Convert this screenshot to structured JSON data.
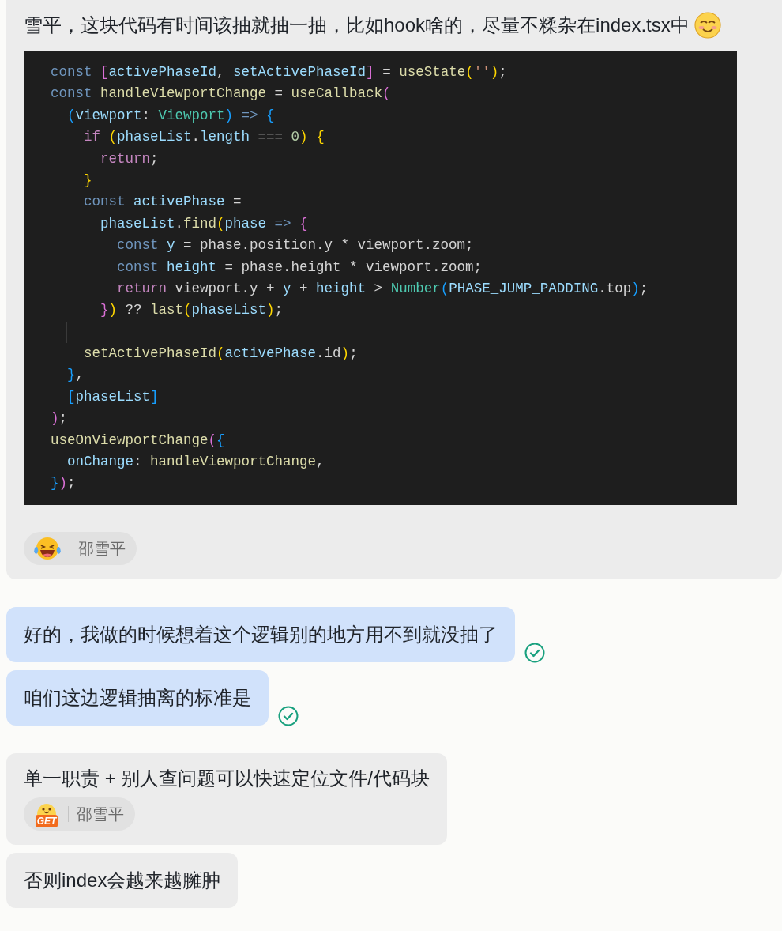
{
  "messages": [
    {
      "kind": "incoming",
      "text": "雪平，这块代码有时间该抽就抽一抽，比如hook啥的，尽量不糅杂在index.tsx中",
      "inline_emoji": {
        "kind": "smiling"
      },
      "code": [
        {
          "tokens": [
            {
              "kind": "keyword",
              "text": "const"
            },
            {
              "kind": "pink",
              "text": " ["
            },
            {
              "kind": "variable",
              "text": "activePhaseId"
            },
            {
              "kind": "plain",
              "text": ", "
            },
            {
              "kind": "variable",
              "text": "setActivePhaseId"
            },
            {
              "kind": "pink",
              "text": "]"
            },
            {
              "kind": "plain",
              "text": " = "
            },
            {
              "kind": "function",
              "text": "useState"
            },
            {
              "kind": "gold",
              "text": "("
            },
            {
              "kind": "string",
              "text": "''"
            },
            {
              "kind": "gold",
              "text": ")"
            },
            {
              "kind": "plain",
              "text": ";"
            }
          ]
        },
        {
          "tokens": [
            {
              "kind": "keyword",
              "text": "const"
            },
            {
              "kind": "function",
              "text": " handleViewportChange"
            },
            {
              "kind": "plain",
              "text": " = "
            },
            {
              "kind": "function",
              "text": "useCallback"
            },
            {
              "kind": "pink",
              "text": "("
            }
          ]
        },
        {
          "tokens": [
            {
              "kind": "blue",
              "text": "  ("
            },
            {
              "kind": "variable",
              "text": "viewport"
            },
            {
              "kind": "plain",
              "text": ": "
            },
            {
              "kind": "type",
              "text": "Viewport"
            },
            {
              "kind": "blue",
              "text": ")"
            },
            {
              "kind": "keyword",
              "text": " =>"
            },
            {
              "kind": "blue",
              "text": " {"
            }
          ]
        },
        {
          "tokens": [
            {
              "kind": "control",
              "text": "    if"
            },
            {
              "kind": "gold",
              "text": " ("
            },
            {
              "kind": "variable",
              "text": "phaseList"
            },
            {
              "kind": "plain",
              "text": "."
            },
            {
              "kind": "variable",
              "text": "length"
            },
            {
              "kind": "plain",
              "text": " === "
            },
            {
              "kind": "number",
              "text": "0"
            },
            {
              "kind": "gold",
              "text": ")"
            },
            {
              "kind": "gold",
              "text": " {"
            }
          ]
        },
        {
          "tokens": [
            {
              "kind": "control",
              "text": "      return"
            },
            {
              "kind": "plain",
              "text": ";"
            }
          ]
        },
        {
          "tokens": [
            {
              "kind": "gold",
              "text": "    }"
            }
          ]
        },
        {
          "tokens": [
            {
              "kind": "keyword",
              "text": "    const"
            },
            {
              "kind": "variable",
              "text": " activePhase"
            },
            {
              "kind": "plain",
              "text": " ="
            }
          ]
        },
        {
          "tokens": [
            {
              "kind": "variable",
              "text": "      phaseList"
            },
            {
              "kind": "plain",
              "text": "."
            },
            {
              "kind": "function",
              "text": "find"
            },
            {
              "kind": "gold",
              "text": "("
            },
            {
              "kind": "variable",
              "text": "phase"
            },
            {
              "kind": "keyword",
              "text": " =>"
            },
            {
              "kind": "pink",
              "text": " {"
            }
          ]
        },
        {
          "tokens": [
            {
              "kind": "keyword",
              "text": "        const"
            },
            {
              "kind": "variable",
              "text": " y"
            },
            {
              "kind": "plain",
              "text": " = phase.position.y * viewport.zoom;"
            }
          ]
        },
        {
          "tokens": [
            {
              "kind": "keyword",
              "text": "        const"
            },
            {
              "kind": "variable",
              "text": " height"
            },
            {
              "kind": "plain",
              "text": " = phase.height * viewport.zoom;"
            }
          ]
        },
        {
          "tokens": [
            {
              "kind": "control",
              "text": "        return"
            },
            {
              "kind": "plain",
              "text": " viewport.y + "
            },
            {
              "kind": "variable",
              "text": "y"
            },
            {
              "kind": "plain",
              "text": " + "
            },
            {
              "kind": "variable",
              "text": "height"
            },
            {
              "kind": "plain",
              "text": " > "
            },
            {
              "kind": "type",
              "text": "Number"
            },
            {
              "kind": "blue",
              "text": "("
            },
            {
              "kind": "variable",
              "text": "PHASE_JUMP_PADDING"
            },
            {
              "kind": "plain",
              "text": ".top"
            },
            {
              "kind": "blue",
              "text": ")"
            },
            {
              "kind": "plain",
              "text": ";"
            }
          ]
        },
        {
          "tokens": [
            {
              "kind": "pink",
              "text": "      }"
            },
            {
              "kind": "gold",
              "text": ")"
            },
            {
              "kind": "plain",
              "text": " ?? "
            },
            {
              "kind": "function",
              "text": "last"
            },
            {
              "kind": "gold",
              "text": "("
            },
            {
              "kind": "variable",
              "text": "phaseList"
            },
            {
              "kind": "gold",
              "text": ")"
            },
            {
              "kind": "plain",
              "text": ";"
            }
          ]
        },
        {
          "blank": true
        },
        {
          "tokens": [
            {
              "kind": "function",
              "text": "    setActivePhaseId"
            },
            {
              "kind": "gold",
              "text": "("
            },
            {
              "kind": "variable",
              "text": "activePhase"
            },
            {
              "kind": "plain",
              "text": ".id"
            },
            {
              "kind": "gold",
              "text": ")"
            },
            {
              "kind": "plain",
              "text": ";"
            }
          ]
        },
        {
          "tokens": [
            {
              "kind": "blue",
              "text": "  }"
            },
            {
              "kind": "plain",
              "text": ","
            }
          ]
        },
        {
          "tokens": [
            {
              "kind": "blue",
              "text": "  ["
            },
            {
              "kind": "variable",
              "text": "phaseList"
            },
            {
              "kind": "blue",
              "text": "]"
            }
          ]
        },
        {
          "tokens": [
            {
              "kind": "pink",
              "text": ")"
            },
            {
              "kind": "plain",
              "text": ";"
            }
          ]
        },
        {
          "tokens": [
            {
              "kind": "function",
              "text": "useOnViewportChange"
            },
            {
              "kind": "pink",
              "text": "("
            },
            {
              "kind": "blue",
              "text": "{"
            }
          ]
        },
        {
          "tokens": [
            {
              "kind": "variable",
              "text": "  onChange"
            },
            {
              "kind": "plain",
              "text": ": "
            },
            {
              "kind": "function",
              "text": "handleViewportChange"
            },
            {
              "kind": "plain",
              "text": ","
            }
          ]
        },
        {
          "tokens": [
            {
              "kind": "blue",
              "text": "}"
            },
            {
              "kind": "pink",
              "text": ")"
            },
            {
              "kind": "plain",
              "text": ";"
            }
          ]
        }
      ],
      "reaction": {
        "kind": "laughing",
        "user": "邵雪平"
      }
    },
    {
      "kind": "outgoing",
      "text": "好的，我做的时候想着这个逻辑别的地方用不到就没抽了",
      "read": true
    },
    {
      "kind": "outgoing",
      "text": "咱们这边逻辑抽离的标准是",
      "read": true
    },
    {
      "kind": "incoming",
      "text": "单一职责 + 别人查问题可以快速定位文件/代码块",
      "reaction": {
        "kind": "get",
        "label": "GET",
        "user": "邵雪平"
      }
    },
    {
      "kind": "incoming",
      "text": "否则index会越来越臃肿"
    }
  ]
}
